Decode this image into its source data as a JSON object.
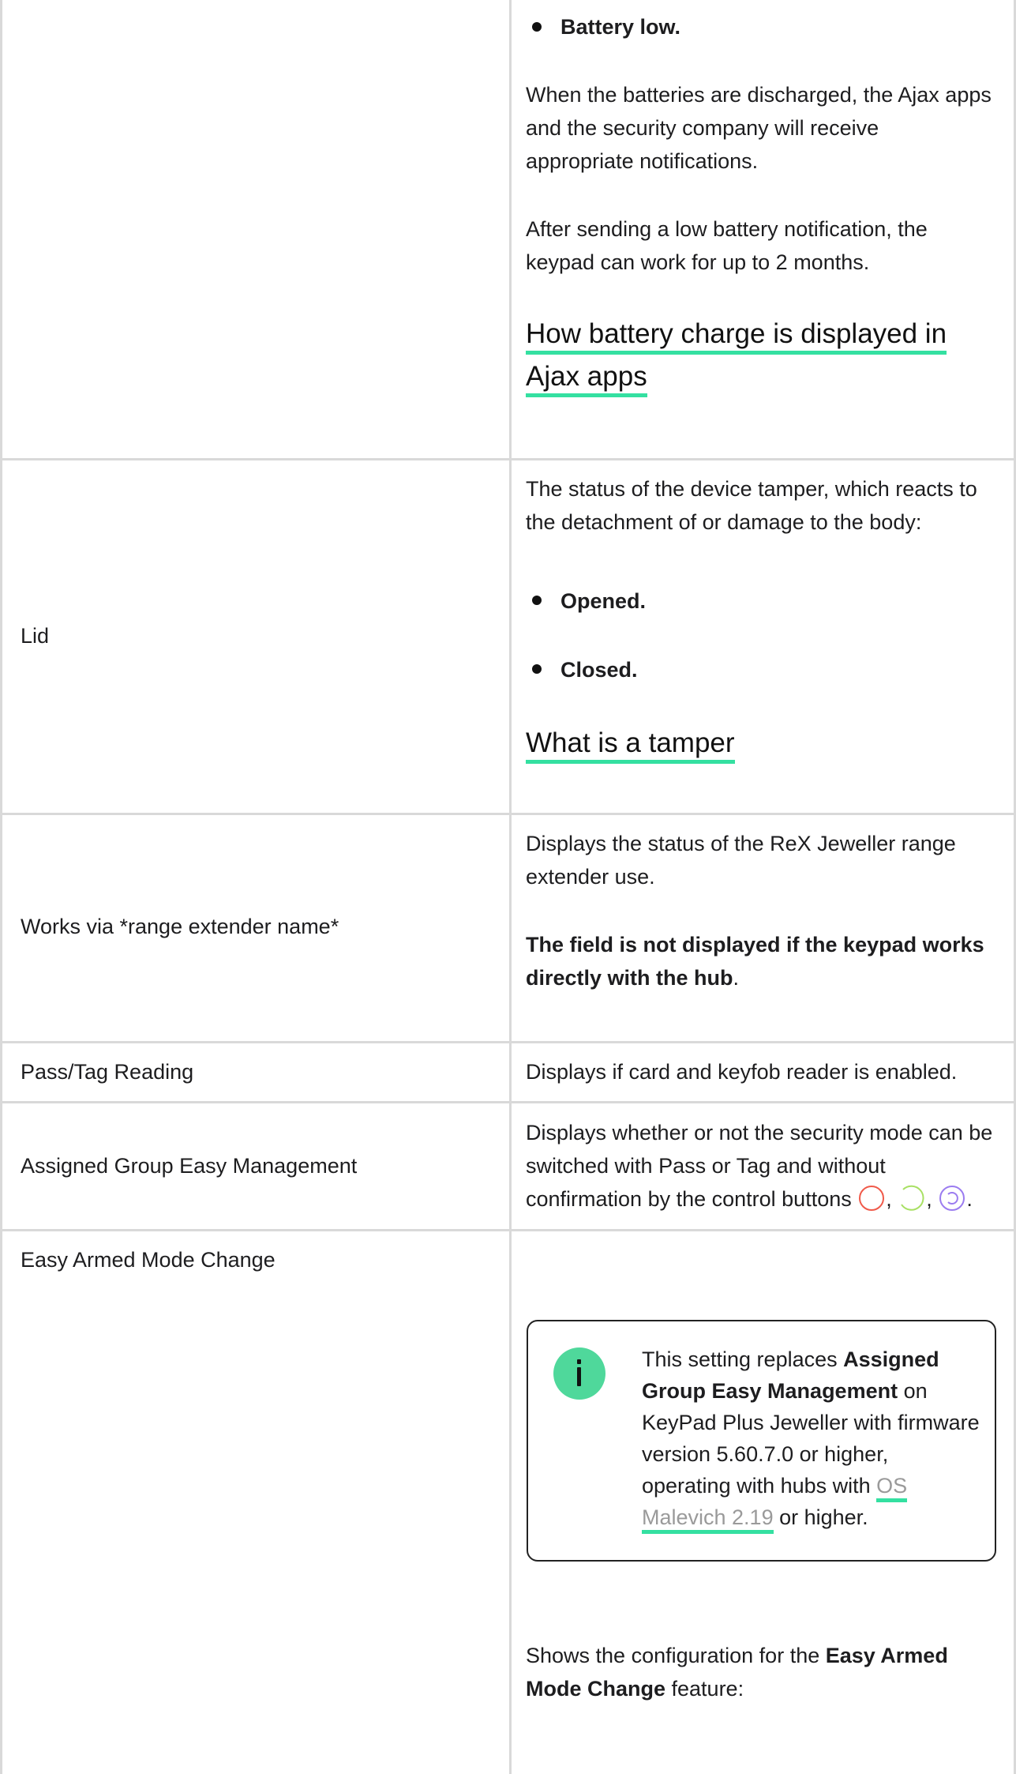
{
  "row_battery": {
    "bullet": "Battery low.",
    "para1": "When the batteries are discharged, the Ajax apps and the security company will receive appropriate notifications.",
    "para2": "After sending a low battery notification, the keypad can work for up to 2 months.",
    "link_line1": "How battery charge is displayed in",
    "link_line2": "Ajax apps"
  },
  "row_lid": {
    "label": "Lid",
    "desc": "The status of the device tamper, which reacts to the detachment of or damage to the body:",
    "bullets": [
      "Opened.",
      "Closed."
    ],
    "link": "What is a tamper"
  },
  "row_works_via": {
    "label": "Works via *range extender name*",
    "desc": "Displays the status of the ReX Jeweller range extender use.",
    "note_bold": "The field is not displayed if the keypad works directly with the hub",
    "note_end": "."
  },
  "row_pass_tag": {
    "label": "Pass/Tag Reading",
    "desc": "Displays if card and keyfob reader is enabled."
  },
  "row_group_easy": {
    "label": "Assigned Group Easy Management",
    "desc": "Displays whether or not the security mode can be switched with Pass or Tag and without confirmation by the control buttons",
    "sep1": ",",
    "sep2": ",",
    "end": ".",
    "icons": [
      "armed-icon",
      "disarmed-icon",
      "night-mode-icon"
    ],
    "icon_colors": [
      "#f05a4a",
      "#a8e063",
      "#9b7cf0"
    ]
  },
  "row_easy_armed": {
    "label": "Easy Armed Mode Change",
    "note_pre": "This setting replaces ",
    "note_bold": "Assigned Group Easy Management",
    "note_mid": " on KeyPad Plus Jeweller with firmware version 5.60.7.0 or higher, operating with hubs with ",
    "note_link": "OS Malevich 2.19",
    "note_post": " or higher.",
    "desc_pre": "Shows the configuration for the ",
    "desc_bold": "Easy Armed Mode Change",
    "desc_post": " feature:",
    "accent_color": "#34e0a1"
  }
}
